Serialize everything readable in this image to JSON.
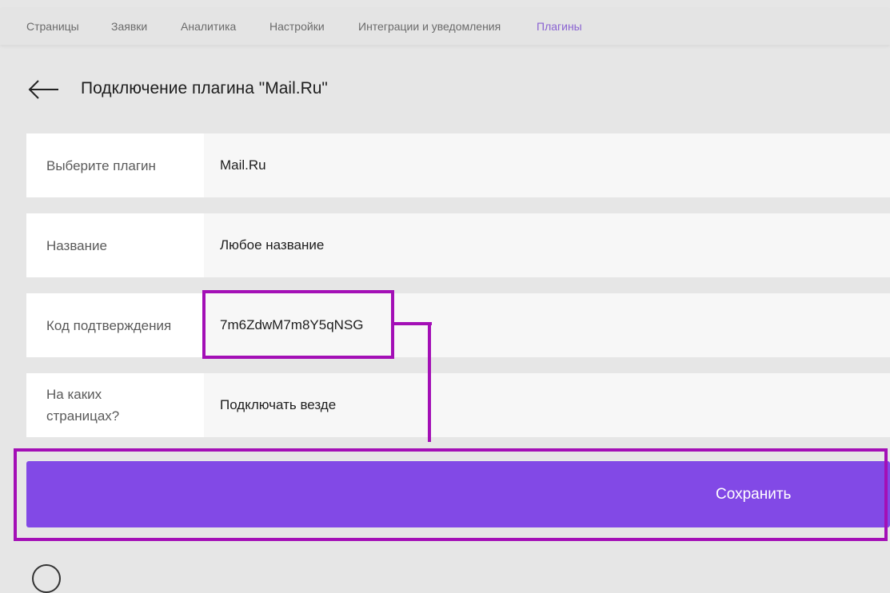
{
  "nav": {
    "tabs": [
      {
        "label": "Страницы"
      },
      {
        "label": "Заявки"
      },
      {
        "label": "Аналитика"
      },
      {
        "label": "Настройки"
      },
      {
        "label": "Интеграции и уведомления"
      },
      {
        "label": "Плагины"
      }
    ],
    "active_tab": "Плагины"
  },
  "header": {
    "title": "Подключение плагина \"Mail.Ru\""
  },
  "form": {
    "plugin": {
      "label": "Выберите плагин",
      "value": "Mail.Ru"
    },
    "name": {
      "label": "Название",
      "value": "Любое название"
    },
    "code": {
      "label": "Код подтверждения",
      "value": "7m6ZdwM7m8Y5qNSG"
    },
    "pages": {
      "label": "На каких страницах?",
      "value": "Подключать везде"
    }
  },
  "actions": {
    "save_label": "Сохранить"
  },
  "colors": {
    "accent": "#8249e6",
    "active_tab": "#8a63d2",
    "highlight": "#a30fb6",
    "background": "#e6e6e6"
  },
  "icons": {
    "back": "arrow-left-icon"
  }
}
